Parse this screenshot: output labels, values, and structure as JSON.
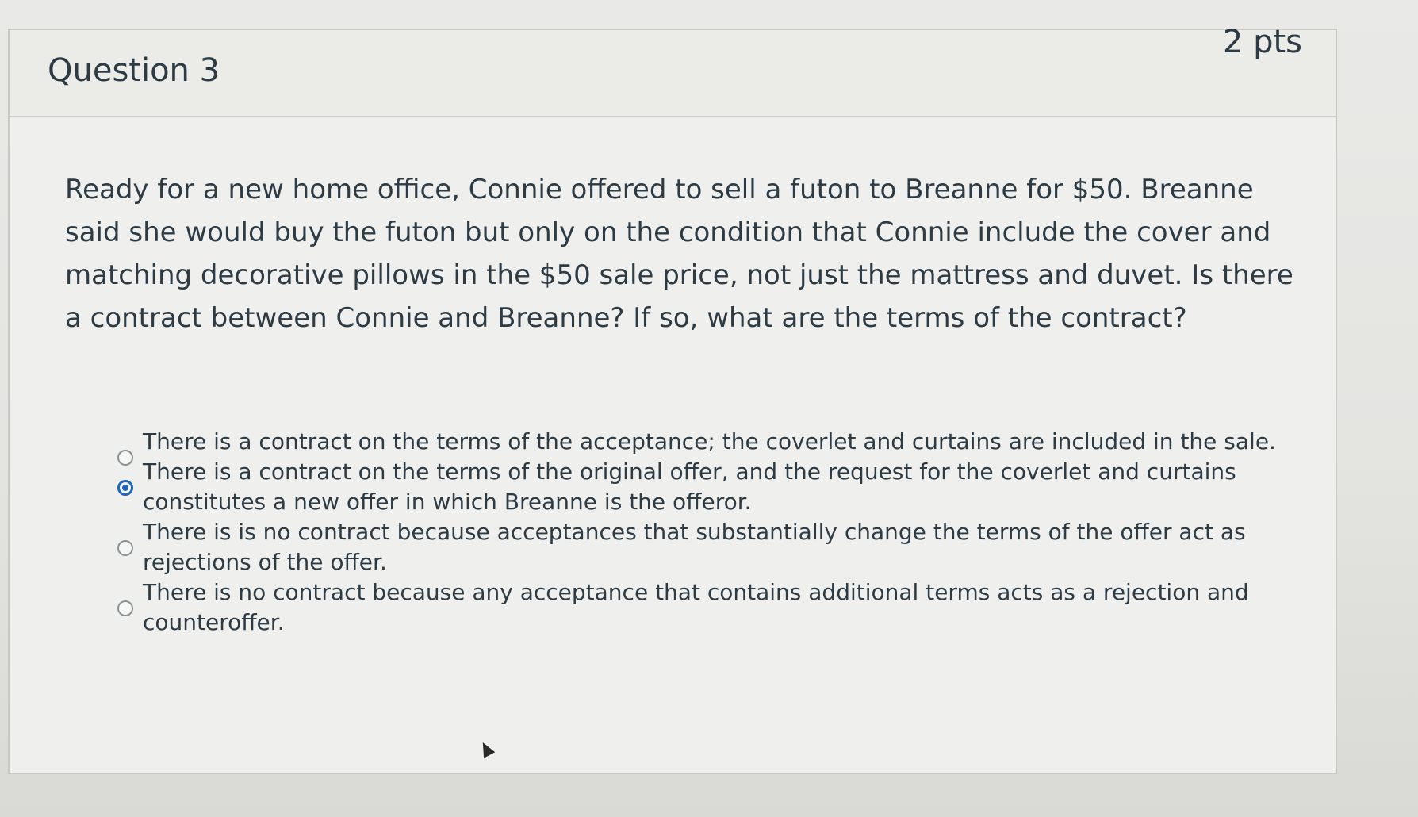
{
  "question": {
    "title": "Question 3",
    "points": "2 pts",
    "text": "Ready for a new home office, Connie offered to sell a futon to Breanne for $50. Breanne said she would buy the futon but only on the condition that Connie include the cover and matching decorative pillows in the $50 sale price, not just the mattress and duvet. Is there a contract between Connie and Breanne? If so, what are the terms of the contract?"
  },
  "answers": [
    {
      "label": "There is a contract on the terms of the acceptance; the coverlet and curtains are included in the sale.",
      "selected": false
    },
    {
      "label": "There is a contract on the terms of the original offer, and the request for the coverlet and curtains constitutes a new offer in which Breanne is the offeror.",
      "selected": true
    },
    {
      "label": "There is is no contract because acceptances that substantially change the terms of the offer act as rejections of the offer.",
      "selected": false
    },
    {
      "label": "There is no contract because any acceptance that contains additional terms acts as a rejection and counteroffer.",
      "selected": false
    }
  ],
  "ui": {
    "radio_selected_color": "#1f65b8",
    "text_color": "#2d3b45"
  },
  "icons": {
    "cursor": "mouse-pointer-icon"
  }
}
